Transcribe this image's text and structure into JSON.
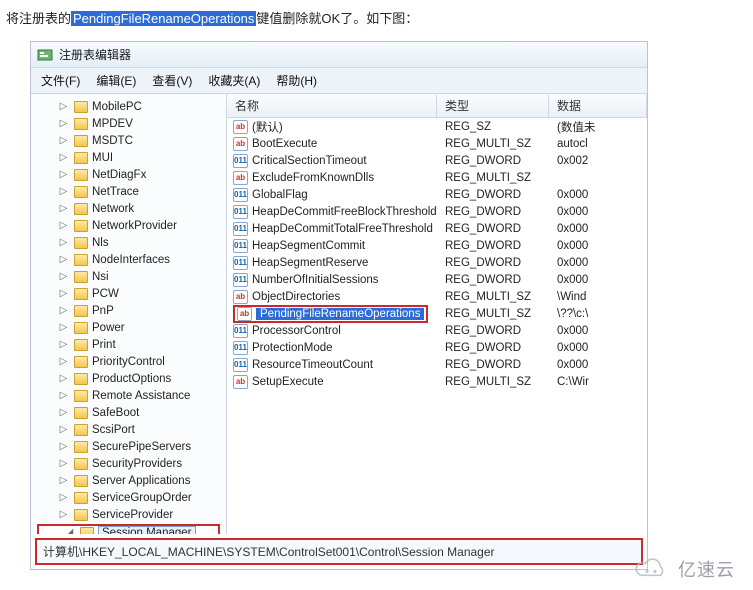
{
  "intro": {
    "pre": "将注册表的",
    "highlight": "PendingFileRenameOperations",
    "post": "键值删除就OK了。如下图："
  },
  "app": {
    "title": "注册表编辑器"
  },
  "menus": {
    "file": "文件(F)",
    "edit": "编辑(E)",
    "view": "查看(V)",
    "fav": "收藏夹(A)",
    "help": "帮助(H)"
  },
  "tree": {
    "items": [
      "MobilePC",
      "MPDEV",
      "MSDTC",
      "MUI",
      "NetDiagFx",
      "NetTrace",
      "Network",
      "NetworkProvider",
      "Nls",
      "NodeInterfaces",
      "Nsi",
      "PCW",
      "PnP",
      "Power",
      "Print",
      "PriorityControl",
      "ProductOptions",
      "Remote Assistance",
      "SafeBoot",
      "ScsiPort",
      "SecurePipeServers",
      "SecurityProviders",
      "Server Applications",
      "ServiceGroupOrder",
      "ServiceProvider"
    ],
    "selected": "Session Manager"
  },
  "columns": {
    "name": "名称",
    "type": "类型",
    "data": "数据"
  },
  "values": [
    {
      "icon": "sz",
      "name": "(默认)",
      "type": "REG_SZ",
      "data": "(数值未"
    },
    {
      "icon": "sz",
      "name": "BootExecute",
      "type": "REG_MULTI_SZ",
      "data": "autocl"
    },
    {
      "icon": "dw",
      "name": "CriticalSectionTimeout",
      "type": "REG_DWORD",
      "data": "0x002"
    },
    {
      "icon": "sz",
      "name": "ExcludeFromKnownDlls",
      "type": "REG_MULTI_SZ",
      "data": ""
    },
    {
      "icon": "dw",
      "name": "GlobalFlag",
      "type": "REG_DWORD",
      "data": "0x000"
    },
    {
      "icon": "dw",
      "name": "HeapDeCommitFreeBlockThreshold",
      "type": "REG_DWORD",
      "data": "0x000"
    },
    {
      "icon": "dw",
      "name": "HeapDeCommitTotalFreeThreshold",
      "type": "REG_DWORD",
      "data": "0x000"
    },
    {
      "icon": "dw",
      "name": "HeapSegmentCommit",
      "type": "REG_DWORD",
      "data": "0x000"
    },
    {
      "icon": "dw",
      "name": "HeapSegmentReserve",
      "type": "REG_DWORD",
      "data": "0x000"
    },
    {
      "icon": "dw",
      "name": "NumberOfInitialSessions",
      "type": "REG_DWORD",
      "data": "0x000"
    },
    {
      "icon": "sz",
      "name": "ObjectDirectories",
      "type": "REG_MULTI_SZ",
      "data": "\\Wind"
    },
    {
      "icon": "sz",
      "name": "PendingFileRenameOperations",
      "type": "REG_MULTI_SZ",
      "data": "\\??\\c:\\",
      "hl": true
    },
    {
      "icon": "dw",
      "name": "ProcessorControl",
      "type": "REG_DWORD",
      "data": "0x000"
    },
    {
      "icon": "dw",
      "name": "ProtectionMode",
      "type": "REG_DWORD",
      "data": "0x000"
    },
    {
      "icon": "dw",
      "name": "ResourceTimeoutCount",
      "type": "REG_DWORD",
      "data": "0x000"
    },
    {
      "icon": "sz",
      "name": "SetupExecute",
      "type": "REG_MULTI_SZ",
      "data": "C:\\Wir"
    }
  ],
  "statusbar": "计算机\\HKEY_LOCAL_MACHINE\\SYSTEM\\ControlSet001\\Control\\Session Manager",
  "watermark": "亿速云"
}
